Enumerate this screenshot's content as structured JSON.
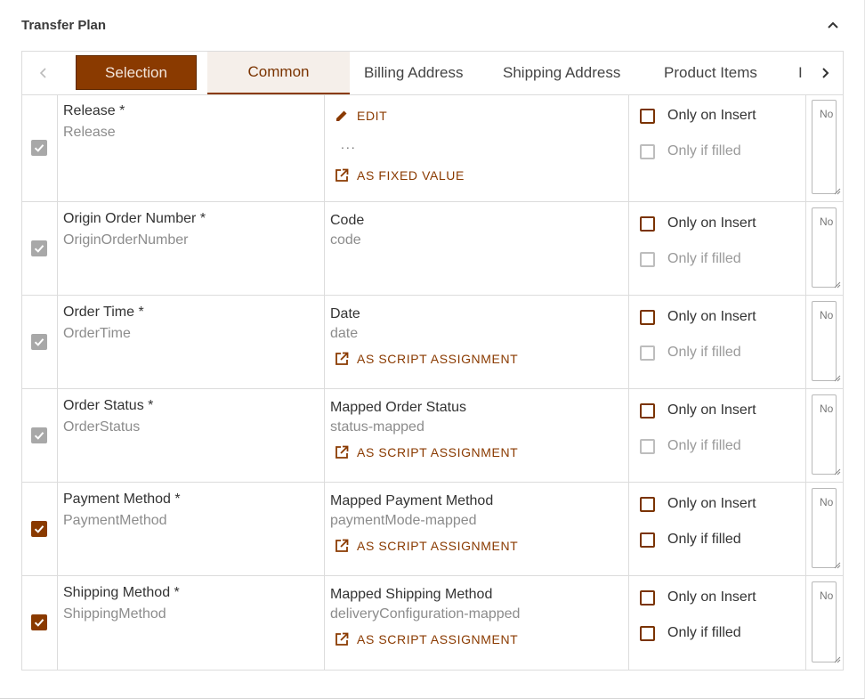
{
  "panel": {
    "title": "Transfer Plan"
  },
  "tabs": {
    "selection": "Selection",
    "common": "Common",
    "billing": "Billing Address",
    "shipping": "Shipping Address",
    "product": "Product Items",
    "more": "I"
  },
  "options": {
    "only_insert": "Only on Insert",
    "only_filled": "Only if filled"
  },
  "note_placeholder": "No",
  "rows": [
    {
      "field_label": "Release *",
      "field_key": "Release",
      "edit_label": "EDIT",
      "dots": "...",
      "action_label": "AS FIXED VALUE",
      "checked": true,
      "disabled": true,
      "only_filled_enabled": false
    },
    {
      "field_label": "Origin Order Number *",
      "field_key": "OriginOrderNumber",
      "map_label": "Code",
      "map_key": "code",
      "checked": true,
      "disabled": true,
      "only_filled_enabled": false
    },
    {
      "field_label": "Order Time *",
      "field_key": "OrderTime",
      "map_label": "Date",
      "map_key": "date",
      "action_label": "AS SCRIPT ASSIGNMENT",
      "checked": true,
      "disabled": true,
      "only_filled_enabled": false
    },
    {
      "field_label": "Order Status *",
      "field_key": "OrderStatus",
      "map_label": "Mapped Order Status",
      "map_key": "status-mapped",
      "action_label": "AS SCRIPT ASSIGNMENT",
      "checked": true,
      "disabled": true,
      "only_filled_enabled": false
    },
    {
      "field_label": "Payment Method *",
      "field_key": "PaymentMethod",
      "map_label": "Mapped Payment Method",
      "map_key": "paymentMode-mapped",
      "action_label": "AS SCRIPT ASSIGNMENT",
      "checked": true,
      "disabled": false,
      "only_filled_enabled": true
    },
    {
      "field_label": "Shipping Method *",
      "field_key": "ShippingMethod",
      "map_label": "Mapped Shipping Method",
      "map_key": "deliveryConfiguration-mapped",
      "action_label": "AS SCRIPT ASSIGNMENT",
      "checked": true,
      "disabled": false,
      "only_filled_enabled": true
    }
  ]
}
